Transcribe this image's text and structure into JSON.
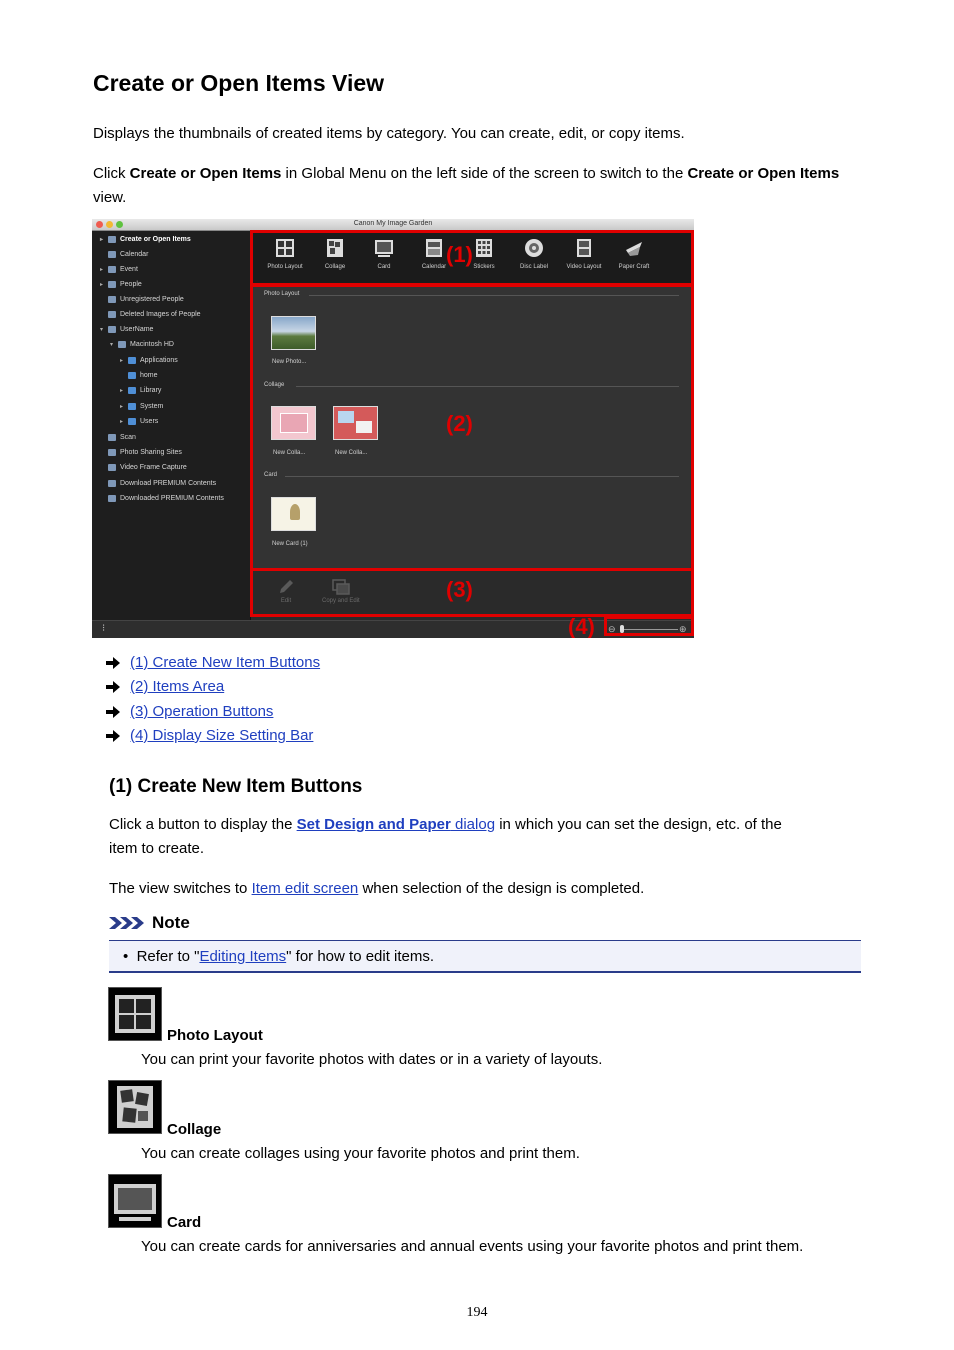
{
  "page": {
    "title": "Create or Open Items View",
    "intro": "Displays the thumbnails of created items by category. You can create, edit, or copy items.",
    "click_prefix": "Click ",
    "click_bold1": "Create or Open Items",
    "click_middle": " in Global Menu on the left side of the screen to switch to the ",
    "click_bold2": "Create or Open Items",
    "click_suffix": " view.",
    "page_number": "194"
  },
  "screenshot": {
    "window_title": "Canon My Image Garden",
    "sidebar": [
      "Create or Open Items",
      "Calendar",
      "Event",
      "People",
      "Unregistered People",
      "Deleted Images of People",
      "UserName",
      "Macintosh HD",
      "Applications",
      "home",
      "Library",
      "System",
      "Users",
      "Scan",
      "Photo Sharing Sites",
      "Video Frame Capture",
      "Download PREMIUM Contents",
      "Downloaded PREMIUM Contents"
    ],
    "toolbar": [
      "Photo Layout",
      "Collage",
      "Card",
      "Calendar",
      "Stickers",
      "Disc Label",
      "Video Layout",
      "Paper Craft"
    ],
    "sections": {
      "photo_layout": "Photo Layout",
      "collage": "Collage",
      "card": "Card"
    },
    "thumbs": {
      "photo": "New Photo...",
      "collage1": "New Colla...",
      "collage2": "New Colla...",
      "card": "New Card (1)"
    },
    "ops": [
      "Edit",
      "Copy and Edit"
    ],
    "callouts": [
      "(1)",
      "(2)",
      "(3)",
      "(4)"
    ]
  },
  "links": [
    "(1) Create New Item Buttons",
    "(2) Items Area",
    "(3) Operation Buttons",
    "(4) Display Size Setting Bar"
  ],
  "section1": {
    "heading": "(1) Create New Item Buttons",
    "p1_prefix": "Click a button to display the ",
    "p1_link_bold": "Set Design and Paper",
    "p1_link_rest": " dialog",
    "p1_suffix": " in which you can set the design, etc. of the",
    "p1_line2": "item to create.",
    "p2_prefix": "The view switches to ",
    "p2_link": "Item edit screen",
    "p2_suffix": " when selection of the design is completed."
  },
  "note": {
    "label": "Note",
    "prefix": "Refer to \"",
    "link": "Editing Items",
    "suffix": "\" for how to edit items."
  },
  "items": [
    {
      "title": "Photo Layout",
      "desc": "You can print your favorite photos with dates or in a variety of layouts.",
      "icon": "photo-layout-icon"
    },
    {
      "title": "Collage",
      "desc": "You can create collages using your favorite photos and print them.",
      "icon": "collage-icon"
    },
    {
      "title": "Card",
      "desc": "You can create cards for anniversaries and annual events using your favorite photos and print them.",
      "icon": "card-icon"
    }
  ],
  "colors": {
    "link": "#1f3fbf",
    "callout": "#e00000",
    "note_border": "#2a3c8a"
  }
}
